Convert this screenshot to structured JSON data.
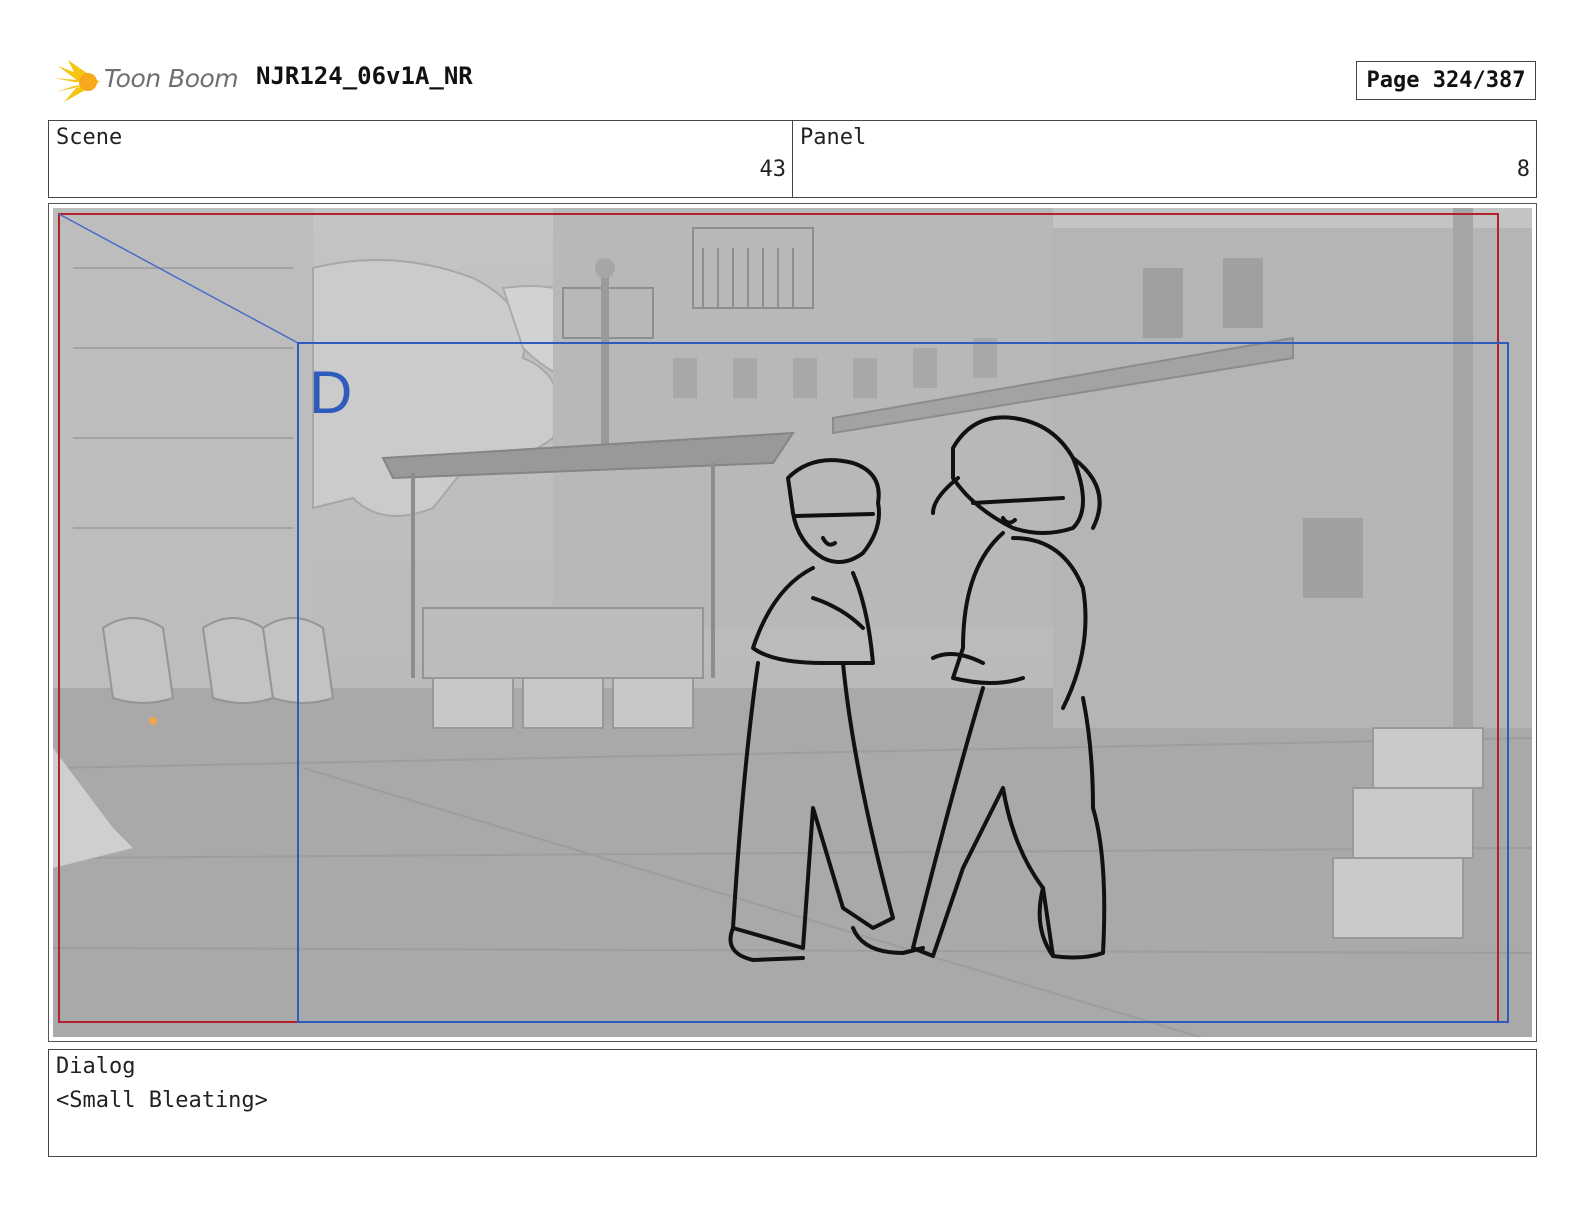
{
  "header": {
    "logo_text": "Toon Boom",
    "document_title": "NJR124_06v1A_NR",
    "page_indicator": "Page 324/387"
  },
  "scene": {
    "label": "Scene",
    "value": "43"
  },
  "panel": {
    "label": "Panel",
    "value": "8"
  },
  "frame": {
    "field_marker": "D"
  },
  "dialog": {
    "label": "Dialog",
    "text": "<Small Bleating>"
  },
  "colors": {
    "logo_yellow": "#f5c518",
    "safe_frame_red": "#b3202e",
    "camera_frame_blue": "#2f5bbd",
    "background_gray": "#b9b9b9"
  }
}
